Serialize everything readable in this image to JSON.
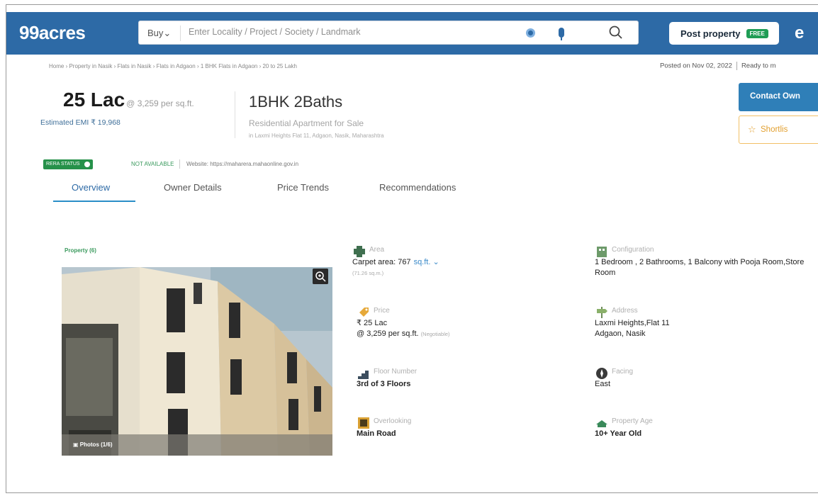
{
  "header": {
    "logo": "99acres",
    "buy_label": "Buy",
    "buy_caret": "⌄",
    "search_placeholder": "Enter Locality / Project / Society / Landmark",
    "post_property_label": "Post property",
    "free_badge": "FREE",
    "user_initial": "e",
    "brand_color": "#2d6aa6"
  },
  "breadcrumb": "Home › Property in Nasik › Flats in Nasik › Flats in Adgaon › 1 BHK Flats in Adgaon › 20 to 25 Lakh",
  "posted": {
    "date": "Posted on Nov 02, 2022",
    "status": "Ready to m"
  },
  "listing": {
    "price": "25 Lac",
    "price_per": "@ 3,259 per sq.ft.",
    "emi": "Estimated EMI ₹ 19,968",
    "config": "1BHK 2Baths",
    "type": "Residential Apartment for Sale",
    "address": "in Laxmi Heights Flat 11, Adgaon, Nasik, Maharashtra"
  },
  "actions": {
    "contact": "Contact Own",
    "shortlist": "Shortlis"
  },
  "rera": {
    "badge": "RERA STATUS",
    "status": "NOT AVAILABLE",
    "website": "Website: https://maharera.mahaonline.gov.in"
  },
  "tabs": [
    "Overview",
    "Owner Details",
    "Price Trends",
    "Recommendations"
  ],
  "gallery": {
    "section_label": "Property (6)",
    "photos_label": "Photos (1/6)"
  },
  "details": {
    "area": {
      "label": "Area",
      "value": "Carpet area: 767",
      "unit": "sq.ft. ⌄",
      "sub": "(71.26 sq.m.)"
    },
    "configuration": {
      "label": "Configuration",
      "value": "1 Bedroom , 2 Bathrooms, 1 Balcony with Pooja Room,Store Room"
    },
    "price": {
      "label": "Price",
      "value": "₹ 25 Lac",
      "value2": "@ 3,259 per sq.ft.",
      "sub": "(Negotiable)"
    },
    "address": {
      "label": "Address",
      "value": "Laxmi Heights,Flat 11",
      "value2": "Adgaon, Nasik"
    },
    "floor": {
      "label": "Floor Number",
      "value": "3rd of 3 Floors"
    },
    "facing": {
      "label": "Facing",
      "value": "East"
    },
    "overlooking": {
      "label": "Overlooking",
      "value": "Main Road"
    },
    "age": {
      "label": "Property Age",
      "value": "10+ Year Old"
    }
  }
}
